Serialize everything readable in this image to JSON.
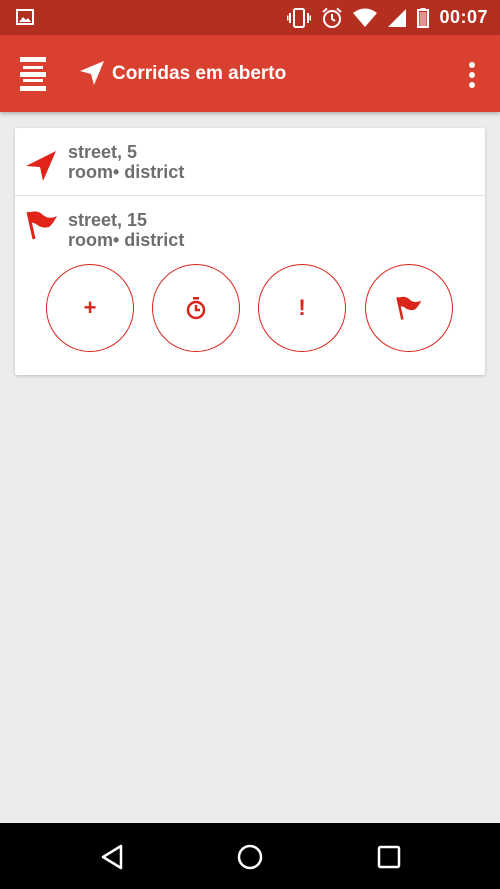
{
  "status_bar": {
    "time": "00:07",
    "icons": [
      "image-icon",
      "vibrate-icon",
      "alarm-icon",
      "wifi-icon",
      "signal-icon",
      "battery-icon"
    ]
  },
  "app_bar": {
    "title": "Corridas em aberto",
    "icons": [
      "menu-icon",
      "navigation-arrow-icon",
      "overflow-menu-icon"
    ]
  },
  "stops": [
    {
      "icon": "navigation-arrow-icon",
      "street": "street, 5",
      "detail": "room• district"
    },
    {
      "icon": "flag-icon",
      "street": "street, 15",
      "detail": "room• district"
    }
  ],
  "actions": [
    {
      "name": "add",
      "glyph": "+",
      "icon": "plus-icon"
    },
    {
      "name": "timer",
      "icon": "stopwatch-icon"
    },
    {
      "name": "alert",
      "glyph": "!",
      "icon": "exclamation-icon"
    },
    {
      "name": "finish",
      "icon": "flag-icon"
    }
  ],
  "nav_bar": {
    "icons": [
      "back-icon",
      "home-icon",
      "recents-icon"
    ]
  },
  "colors": {
    "status_bar": "#b52f21",
    "app_bar": "#d94030",
    "accent": "#d8261b",
    "text": "#6e6e6e",
    "background": "#ececec"
  }
}
